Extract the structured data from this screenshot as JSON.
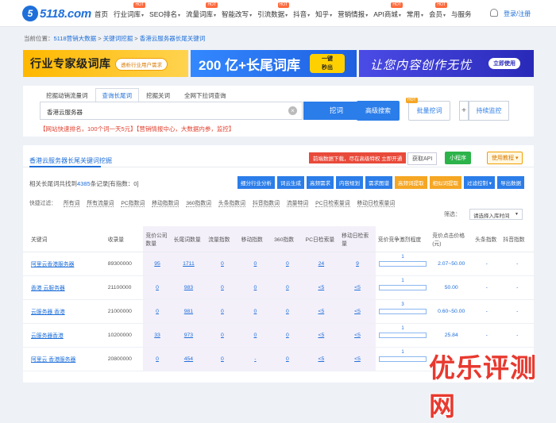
{
  "logo": {
    "text": "5118.com",
    "mark": "5"
  },
  "nav": [
    {
      "label": "首页",
      "hot": false,
      "caret": false
    },
    {
      "label": "行业词库",
      "hot": true,
      "caret": true
    },
    {
      "label": "SEO排名",
      "hot": false,
      "caret": true
    },
    {
      "label": "流量词库",
      "hot": true,
      "caret": true
    },
    {
      "label": "智能改写",
      "hot": false,
      "caret": true
    },
    {
      "label": "引流数据",
      "hot": true,
      "caret": true
    },
    {
      "label": "抖音",
      "hot": false,
      "caret": true
    },
    {
      "label": "知乎",
      "hot": false,
      "caret": true
    },
    {
      "label": "营销情报",
      "hot": false,
      "caret": true
    },
    {
      "label": "API商城",
      "hot": true,
      "caret": true
    },
    {
      "label": "常用",
      "hot": false,
      "caret": true
    },
    {
      "label": "会员",
      "hot": true,
      "caret": true
    },
    {
      "label": "与服务",
      "hot": false,
      "caret": false
    }
  ],
  "hot_label": "HOT",
  "login": "登录/注册",
  "crumb": {
    "prefix": "当前位置：",
    "items": [
      "5118营销大数据",
      "关键词挖掘",
      "香港云服务器长尾关键词"
    ],
    "sep": " > "
  },
  "banners": {
    "b1_title": "行业专家级词库",
    "b1_pill": "透析行业用户需求",
    "b2_title": "200 亿+长尾词库",
    "b2_btn1": "一键",
    "b2_btn2": "秒出",
    "b3_title": "让您内容创作无忧",
    "b3_btn": "立即使用"
  },
  "tabs": [
    "挖掘动销流量词",
    "查询长尾词",
    "挖掘关词",
    "全网下拉词查询"
  ],
  "search": {
    "value": "香港云服务器",
    "dig": "挖词",
    "advanced": "高级搜索",
    "batch": "批量挖词",
    "plus": "+",
    "monitor": "持续监控",
    "clear": "×"
  },
  "notice": "【网站快速排名，100个词一天5元】【营销情报中心，大数据内参，监控】",
  "panel": {
    "title": "香港云服务器长尾关键词挖掘",
    "red_tag": "前端数据下载，尽在高级特权 立即开通",
    "api": "获取API",
    "mini": "小程序",
    "tutorial": "使用教程 ▾",
    "count_prefix": "相关长尾词共找到",
    "count_num": "4385",
    "count_suffix": "条记录[有指数：0]",
    "actions": [
      "细分行业分析",
      "词云生成",
      "高频需求",
      "内容规划",
      "需求图谱",
      "高频词提取",
      "相似词提取",
      "过滤控制 ▾",
      "导出数据"
    ],
    "filter_label": "快捷过滤：",
    "filters": [
      "所有词",
      "所有流量词",
      "PC指数词",
      "移动指数词",
      "360指数词",
      "头条指数词",
      "抖音指数词",
      "流量特词",
      "PC日检索量词",
      "移动日检索量词"
    ],
    "sort_label": "筛选：",
    "sort_value": "请选择入库时间"
  },
  "table": {
    "headers": [
      "关键词",
      "收录量",
      "竞价公司数量",
      "长尾词数量",
      "流量指数",
      "移动指数",
      "360指数",
      "PC日检索量",
      "移动日检索量",
      "竞价竞争激烈程度",
      "竞价点击价格(元)",
      "头条指数",
      "抖音指数"
    ],
    "rows": [
      {
        "kw": "阿里云香港服务器",
        "inc": "89300000",
        "bid": "95",
        "long": "1711",
        "flow": "0",
        "mob": "0",
        "s360": "0",
        "pc": "24",
        "mpc": "9",
        "comp": "1",
        "price": "2.07~50.00",
        "tt": "-",
        "dy": "-"
      },
      {
        "kw": "香港 云服务器",
        "inc": "21100000",
        "bid": "0",
        "long": "983",
        "flow": "0",
        "mob": "0",
        "s360": "0",
        "pc": "<5",
        "mpc": "<5",
        "comp": "1",
        "price": "50.00",
        "tt": "-",
        "dy": "-"
      },
      {
        "kw": "云服务器 香港",
        "inc": "21000000",
        "bid": "0",
        "long": "981",
        "flow": "0",
        "mob": "0",
        "s360": "0",
        "pc": "<5",
        "mpc": "<5",
        "comp": "3",
        "price": "0.60~50.00",
        "tt": "-",
        "dy": "-"
      },
      {
        "kw": "云服务器香港",
        "inc": "10200000",
        "bid": "33",
        "long": "973",
        "flow": "0",
        "mob": "0",
        "s360": "0",
        "pc": "<5",
        "mpc": "<5",
        "comp": "1",
        "price": "25.84",
        "tt": "-",
        "dy": "-"
      },
      {
        "kw": "阿里云 香港服务器",
        "inc": "20800000",
        "bid": "0",
        "long": "454",
        "flow": "0",
        "mob": "-",
        "s360": "0",
        "pc": "<5",
        "mpc": "<5",
        "comp": "1",
        "price": "",
        "tt": "-",
        "dy": "-"
      }
    ]
  },
  "watermark": "优乐评测网",
  "colors": {
    "accent": "#1e6fd9",
    "watermark": "#e8392f",
    "hot": "#ff6a3d"
  }
}
